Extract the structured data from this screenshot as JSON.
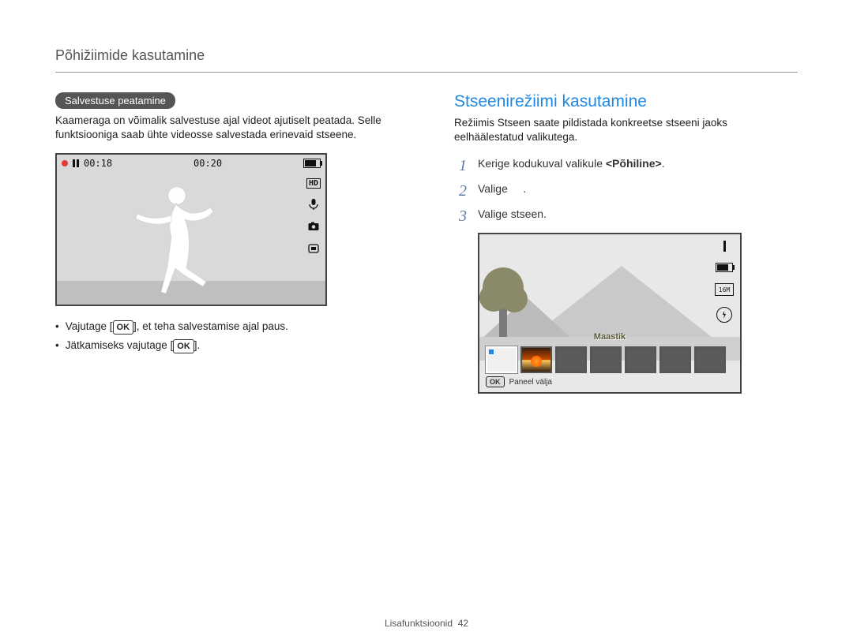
{
  "header": {
    "title": "Põhižiimide kasutamine"
  },
  "left": {
    "pill": "Salvestuse peatamine",
    "para": "Kaameraga on võimalik salvestuse ajal videot ajutiselt peatada. Selle funktsiooniga saab ühte videosse salvestada erinevaid stseene.",
    "rec_left": "00:18",
    "rec_right": "00:20",
    "hd": "HD",
    "ok": "OK",
    "bullet1_before": "Vajutage [",
    "bullet1_after": "], et teha salvestamise ajal paus.",
    "bullet2_before": "Jätkamiseks vajutage [",
    "bullet2_after": "]."
  },
  "right": {
    "title": "Stseenirežiimi kasutamine",
    "para": "Režiimis Stseen saate pildistada konkreetse stseeni jaoks eelhäälestatud valikutega.",
    "steps": {
      "s1": "Kerige kodukuval valikule ",
      "s1_strong": "<Põhiline>",
      "s1_after": ".",
      "s2_before": "Valige ",
      "s2_after": ".",
      "s3": "Valige stseen."
    },
    "scene_name": "Maastik",
    "sixteen": "16M",
    "ok_panel_before": "",
    "ok_panel_label": "Paneel välja",
    "ok": "OK"
  },
  "footer": {
    "section": "Lisafunktsioonid",
    "page": "42"
  }
}
